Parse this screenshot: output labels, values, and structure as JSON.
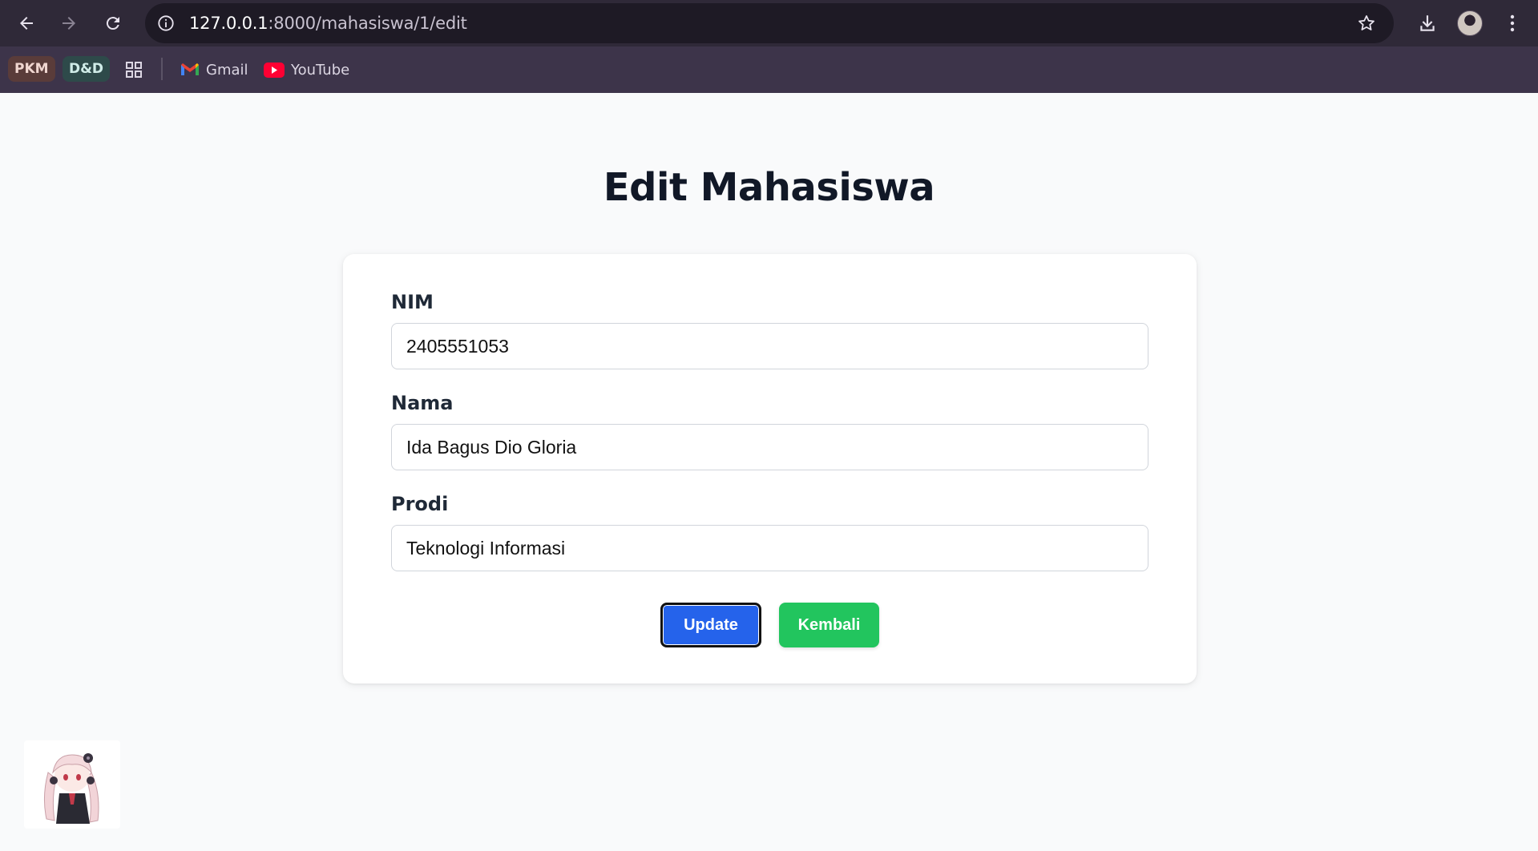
{
  "browser": {
    "url_host": "127.0.0.1",
    "url_path": ":8000/mahasiswa/1/edit",
    "bookmarks": {
      "pkm": "PKM",
      "dnd": "D&D",
      "gmail": "Gmail",
      "youtube": "YouTube"
    },
    "colors": {
      "toolbar": "#2f2938",
      "bookmark_bar": "#3d344a",
      "omnibox": "#1e1a25"
    }
  },
  "page": {
    "title": "Edit Mahasiswa",
    "form": {
      "nim": {
        "label": "NIM",
        "value": "2405551053"
      },
      "nama": {
        "label": "Nama",
        "value": "Ida Bagus Dio Gloria"
      },
      "prodi": {
        "label": "Prodi",
        "value": "Teknologi Informasi"
      }
    },
    "buttons": {
      "update": "Update",
      "kembali": "Kembali"
    },
    "colors": {
      "update": "#2563eb",
      "kembali": "#22c55e",
      "background": "#f9fafb"
    }
  }
}
